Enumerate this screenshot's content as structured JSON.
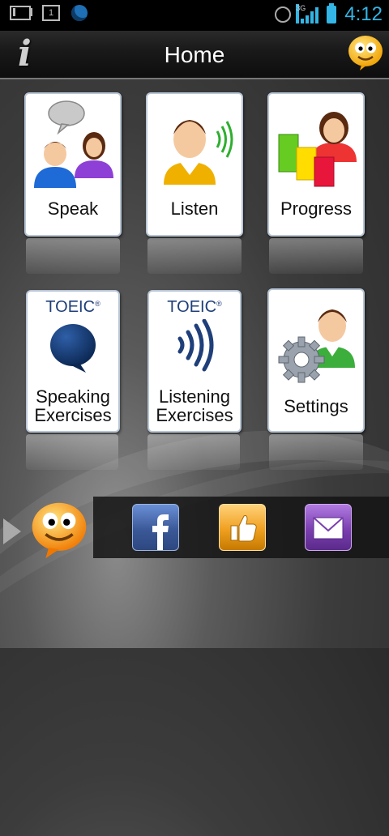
{
  "status_bar": {
    "time": "4:12",
    "network": "3G",
    "calendar_day": "1"
  },
  "header": {
    "title": "Home"
  },
  "tiles": [
    {
      "label": "Speak"
    },
    {
      "label": "Listen"
    },
    {
      "label": "Progress"
    },
    {
      "brand": "TOEIC",
      "label_line1": "Speaking",
      "label_line2": "Exercises"
    },
    {
      "brand": "TOEIC",
      "label_line1": "Listening",
      "label_line2": "Exercises"
    },
    {
      "label": "Settings"
    }
  ],
  "icons": {
    "info": "i",
    "registered": "®"
  },
  "colors": {
    "status_accent": "#33b5e5",
    "toeic_blue": "#1e3f7a",
    "facebook": "#3b5998",
    "like": "#f0a020",
    "mail": "#7b3fb0"
  }
}
